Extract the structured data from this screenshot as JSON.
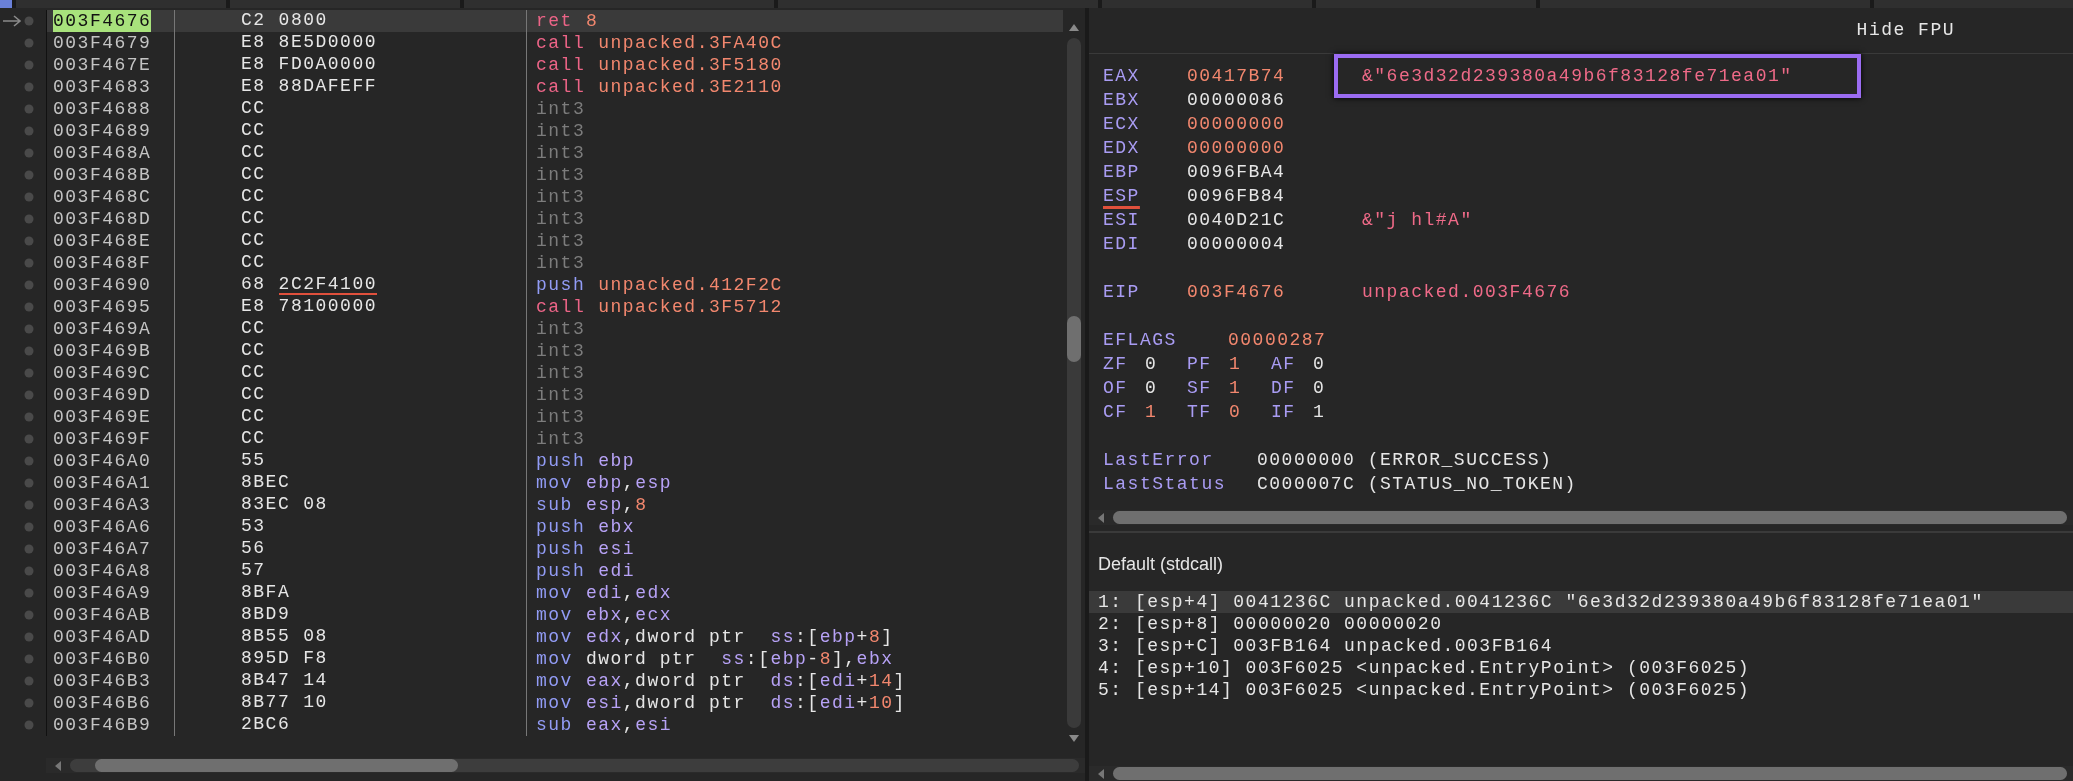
{
  "disassembly": {
    "rows": [
      {
        "address": "003F4676",
        "current": true,
        "selected": true,
        "bytes": [
          "C2",
          "0800"
        ],
        "underlined": false,
        "instruction": [
          {
            "text": "ret",
            "kind": "branch"
          },
          {
            "text": "8",
            "kind": "num"
          }
        ]
      },
      {
        "address": "003F4679",
        "current": false,
        "selected": false,
        "bytes": [
          "E8",
          "8E5D0000"
        ],
        "underlined": false,
        "instruction": [
          {
            "text": "call",
            "kind": "branch"
          },
          {
            "text": "unpacked.3FA40C",
            "kind": "label"
          }
        ]
      },
      {
        "address": "003F467E",
        "current": false,
        "selected": false,
        "bytes": [
          "E8",
          "FD0A0000"
        ],
        "underlined": false,
        "instruction": [
          {
            "text": "call",
            "kind": "branch"
          },
          {
            "text": "unpacked.3F5180",
            "kind": "label"
          }
        ]
      },
      {
        "address": "003F4683",
        "current": false,
        "selected": false,
        "bytes": [
          "E8",
          "88DAFEFF"
        ],
        "underlined": false,
        "instruction": [
          {
            "text": "call",
            "kind": "branch"
          },
          {
            "text": "unpacked.3E2110",
            "kind": "label"
          }
        ]
      },
      {
        "address": "003F4688",
        "current": false,
        "selected": false,
        "bytes": [
          "CC"
        ],
        "underlined": false,
        "instruction": [
          {
            "text": "int3",
            "kind": "nop"
          }
        ]
      },
      {
        "address": "003F4689",
        "current": false,
        "selected": false,
        "bytes": [
          "CC"
        ],
        "underlined": false,
        "instruction": [
          {
            "text": "int3",
            "kind": "nop"
          }
        ]
      },
      {
        "address": "003F468A",
        "current": false,
        "selected": false,
        "bytes": [
          "CC"
        ],
        "underlined": false,
        "instruction": [
          {
            "text": "int3",
            "kind": "nop"
          }
        ]
      },
      {
        "address": "003F468B",
        "current": false,
        "selected": false,
        "bytes": [
          "CC"
        ],
        "underlined": false,
        "instruction": [
          {
            "text": "int3",
            "kind": "nop"
          }
        ]
      },
      {
        "address": "003F468C",
        "current": false,
        "selected": false,
        "bytes": [
          "CC"
        ],
        "underlined": false,
        "instruction": [
          {
            "text": "int3",
            "kind": "nop"
          }
        ]
      },
      {
        "address": "003F468D",
        "current": false,
        "selected": false,
        "bytes": [
          "CC"
        ],
        "underlined": false,
        "instruction": [
          {
            "text": "int3",
            "kind": "nop"
          }
        ]
      },
      {
        "address": "003F468E",
        "current": false,
        "selected": false,
        "bytes": [
          "CC"
        ],
        "underlined": false,
        "instruction": [
          {
            "text": "int3",
            "kind": "nop"
          }
        ]
      },
      {
        "address": "003F468F",
        "current": false,
        "selected": false,
        "bytes": [
          "CC"
        ],
        "underlined": false,
        "instruction": [
          {
            "text": "int3",
            "kind": "nop"
          }
        ]
      },
      {
        "address": "003F4690",
        "current": false,
        "selected": false,
        "bytes": [
          "68",
          "2C2F4100"
        ],
        "underlined": true,
        "instruction": [
          {
            "text": "push",
            "kind": "op"
          },
          {
            "text": "unpacked.412F2C",
            "kind": "label"
          }
        ]
      },
      {
        "address": "003F4695",
        "current": false,
        "selected": false,
        "bytes": [
          "E8",
          "78100000"
        ],
        "underlined": false,
        "instruction": [
          {
            "text": "call",
            "kind": "branch"
          },
          {
            "text": "unpacked.3F5712",
            "kind": "label"
          }
        ]
      },
      {
        "address": "003F469A",
        "current": false,
        "selected": false,
        "bytes": [
          "CC"
        ],
        "underlined": false,
        "instruction": [
          {
            "text": "int3",
            "kind": "nop"
          }
        ]
      },
      {
        "address": "003F469B",
        "current": false,
        "selected": false,
        "bytes": [
          "CC"
        ],
        "underlined": false,
        "instruction": [
          {
            "text": "int3",
            "kind": "nop"
          }
        ]
      },
      {
        "address": "003F469C",
        "current": false,
        "selected": false,
        "bytes": [
          "CC"
        ],
        "underlined": false,
        "instruction": [
          {
            "text": "int3",
            "kind": "nop"
          }
        ]
      },
      {
        "address": "003F469D",
        "current": false,
        "selected": false,
        "bytes": [
          "CC"
        ],
        "underlined": false,
        "instruction": [
          {
            "text": "int3",
            "kind": "nop"
          }
        ]
      },
      {
        "address": "003F469E",
        "current": false,
        "selected": false,
        "bytes": [
          "CC"
        ],
        "underlined": false,
        "instruction": [
          {
            "text": "int3",
            "kind": "nop"
          }
        ]
      },
      {
        "address": "003F469F",
        "current": false,
        "selected": false,
        "bytes": [
          "CC"
        ],
        "underlined": false,
        "instruction": [
          {
            "text": "int3",
            "kind": "nop"
          }
        ]
      },
      {
        "address": "003F46A0",
        "current": false,
        "selected": false,
        "bytes": [
          "55"
        ],
        "underlined": false,
        "instruction": [
          {
            "text": "push",
            "kind": "op"
          },
          {
            "text": "ebp",
            "kind": "reg"
          }
        ]
      },
      {
        "address": "003F46A1",
        "current": false,
        "selected": false,
        "bytes": [
          "8BEC"
        ],
        "underlined": false,
        "instruction": [
          {
            "text": "mov",
            "kind": "op"
          },
          {
            "text": "ebp",
            "kind": "reg"
          },
          {
            "text": ",",
            "kind": "plain"
          },
          {
            "text": "esp",
            "kind": "reg"
          }
        ]
      },
      {
        "address": "003F46A3",
        "current": false,
        "selected": false,
        "bytes": [
          "83EC",
          "08"
        ],
        "underlined": false,
        "instruction": [
          {
            "text": "sub",
            "kind": "op"
          },
          {
            "text": "esp",
            "kind": "reg"
          },
          {
            "text": ",",
            "kind": "plain"
          },
          {
            "text": "8",
            "kind": "num"
          }
        ]
      },
      {
        "address": "003F46A6",
        "current": false,
        "selected": false,
        "bytes": [
          "53"
        ],
        "underlined": false,
        "instruction": [
          {
            "text": "push",
            "kind": "op"
          },
          {
            "text": "ebx",
            "kind": "reg"
          }
        ]
      },
      {
        "address": "003F46A7",
        "current": false,
        "selected": false,
        "bytes": [
          "56"
        ],
        "underlined": false,
        "instruction": [
          {
            "text": "push",
            "kind": "op"
          },
          {
            "text": "esi",
            "kind": "reg"
          }
        ]
      },
      {
        "address": "003F46A8",
        "current": false,
        "selected": false,
        "bytes": [
          "57"
        ],
        "underlined": false,
        "instruction": [
          {
            "text": "push",
            "kind": "op"
          },
          {
            "text": "edi",
            "kind": "reg"
          }
        ]
      },
      {
        "address": "003F46A9",
        "current": false,
        "selected": false,
        "bytes": [
          "8BFA"
        ],
        "underlined": false,
        "instruction": [
          {
            "text": "mov",
            "kind": "op"
          },
          {
            "text": "edi",
            "kind": "reg"
          },
          {
            "text": ",",
            "kind": "plain"
          },
          {
            "text": "edx",
            "kind": "reg"
          }
        ]
      },
      {
        "address": "003F46AB",
        "current": false,
        "selected": false,
        "bytes": [
          "8BD9"
        ],
        "underlined": false,
        "instruction": [
          {
            "text": "mov",
            "kind": "op"
          },
          {
            "text": "ebx",
            "kind": "reg"
          },
          {
            "text": ",",
            "kind": "plain"
          },
          {
            "text": "ecx",
            "kind": "reg"
          }
        ]
      },
      {
        "address": "003F46AD",
        "current": false,
        "selected": false,
        "bytes": [
          "8B55",
          "08"
        ],
        "underlined": false,
        "instruction": [
          {
            "text": "mov",
            "kind": "op"
          },
          {
            "text": "edx",
            "kind": "reg"
          },
          {
            "text": ",dword ptr  ",
            "kind": "plain"
          },
          {
            "text": "ss",
            "kind": "reg"
          },
          {
            "text": ":[",
            "kind": "plain"
          },
          {
            "text": "ebp",
            "kind": "reg"
          },
          {
            "text": "+",
            "kind": "plain"
          },
          {
            "text": "8",
            "kind": "num"
          },
          {
            "text": "]",
            "kind": "plain"
          }
        ]
      },
      {
        "address": "003F46B0",
        "current": false,
        "selected": false,
        "bytes": [
          "895D",
          "F8"
        ],
        "underlined": false,
        "instruction": [
          {
            "text": "mov",
            "kind": "op"
          },
          {
            "text": "dword ptr  ",
            "kind": "plain"
          },
          {
            "text": "ss",
            "kind": "reg"
          },
          {
            "text": ":[",
            "kind": "plain"
          },
          {
            "text": "ebp",
            "kind": "reg"
          },
          {
            "text": "-",
            "kind": "plain"
          },
          {
            "text": "8",
            "kind": "num"
          },
          {
            "text": "],",
            "kind": "plain"
          },
          {
            "text": "ebx",
            "kind": "reg"
          }
        ]
      },
      {
        "address": "003F46B3",
        "current": false,
        "selected": false,
        "bytes": [
          "8B47",
          "14"
        ],
        "underlined": false,
        "instruction": [
          {
            "text": "mov",
            "kind": "op"
          },
          {
            "text": "eax",
            "kind": "reg"
          },
          {
            "text": ",dword ptr  ",
            "kind": "plain"
          },
          {
            "text": "ds",
            "kind": "reg"
          },
          {
            "text": ":[",
            "kind": "plain"
          },
          {
            "text": "edi",
            "kind": "reg"
          },
          {
            "text": "+",
            "kind": "plain"
          },
          {
            "text": "14",
            "kind": "num"
          },
          {
            "text": "]",
            "kind": "plain"
          }
        ]
      },
      {
        "address": "003F46B6",
        "current": false,
        "selected": false,
        "bytes": [
          "8B77",
          "10"
        ],
        "underlined": false,
        "instruction": [
          {
            "text": "mov",
            "kind": "op"
          },
          {
            "text": "esi",
            "kind": "reg"
          },
          {
            "text": ",dword ptr  ",
            "kind": "plain"
          },
          {
            "text": "ds",
            "kind": "reg"
          },
          {
            "text": ":[",
            "kind": "plain"
          },
          {
            "text": "edi",
            "kind": "reg"
          },
          {
            "text": "+",
            "kind": "plain"
          },
          {
            "text": "10",
            "kind": "num"
          },
          {
            "text": "]",
            "kind": "plain"
          }
        ]
      },
      {
        "address": "003F46B9",
        "current": false,
        "selected": false,
        "bytes": [
          "2BC6"
        ],
        "underlined": false,
        "instruction": [
          {
            "text": "sub",
            "kind": "op"
          },
          {
            "text": "eax",
            "kind": "reg"
          },
          {
            "text": ",",
            "kind": "plain"
          },
          {
            "text": "esi",
            "kind": "reg"
          }
        ]
      }
    ]
  },
  "registers_panel": {
    "toggle": "Hide FPU",
    "registers": [
      {
        "name": "EAX",
        "value": "00417B74",
        "changed": true,
        "underlined": false,
        "comment": {
          "text": "&\"6e3d32d239380a49b6f83128fe71ea01\"",
          "boxed": true
        }
      },
      {
        "name": "EBX",
        "value": "00000086",
        "changed": false,
        "underlined": false
      },
      {
        "name": "ECX",
        "value": "00000000",
        "changed": true,
        "underlined": false
      },
      {
        "name": "EDX",
        "value": "00000000",
        "changed": true,
        "underlined": false
      },
      {
        "name": "EBP",
        "value": "0096FBA4",
        "changed": false,
        "underlined": false
      },
      {
        "name": "ESP",
        "value": "0096FB84",
        "changed": false,
        "underlined": true
      },
      {
        "name": "ESI",
        "value": "0040D21C",
        "changed": false,
        "underlined": false,
        "comment": {
          "text": "&\"j hl#A\"",
          "boxed": false
        }
      },
      {
        "name": "EDI",
        "value": "00000004",
        "changed": false,
        "underlined": false
      }
    ],
    "eip": {
      "name": "EIP",
      "value": "003F4676",
      "changed": true,
      "comment": "unpacked.003F4676"
    },
    "eflags": {
      "name": "EFLAGS",
      "value": "00000287",
      "changed": true
    },
    "flags": [
      {
        "name": "ZF",
        "value": "0",
        "changed": false
      },
      {
        "name": "PF",
        "value": "1",
        "changed": true
      },
      {
        "name": "AF",
        "value": "0",
        "changed": false
      },
      {
        "name": "OF",
        "value": "0",
        "changed": false
      },
      {
        "name": "SF",
        "value": "1",
        "changed": true
      },
      {
        "name": "DF",
        "value": "0",
        "changed": false
      },
      {
        "name": "CF",
        "value": "1",
        "changed": true
      },
      {
        "name": "TF",
        "value": "0",
        "changed": true
      },
      {
        "name": "IF",
        "value": "1",
        "changed": false
      }
    ],
    "status": [
      {
        "name": "LastError",
        "value": "00000000 (ERROR_SUCCESS)"
      },
      {
        "name": "LastStatus",
        "value": "C000007C (STATUS_NO_TOKEN)"
      }
    ]
  },
  "call_stack": {
    "convention": "Default (stdcall)",
    "arguments": [
      {
        "text": "1: [esp+4] 0041236C unpacked.0041236C \"6e3d32d239380a49b6f83128fe71ea01\"",
        "selected": true
      },
      {
        "text": "2: [esp+8] 00000020 00000020",
        "selected": false
      },
      {
        "text": "3: [esp+C] 003FB164 unpacked.003FB164",
        "selected": false
      },
      {
        "text": "4: [esp+10] 003F6025 <unpacked.EntryPoint> (003F6025)",
        "selected": false
      },
      {
        "text": "5: [esp+14] 003F6025 <unpacked.EntryPoint> (003F6025)",
        "selected": false
      }
    ]
  }
}
